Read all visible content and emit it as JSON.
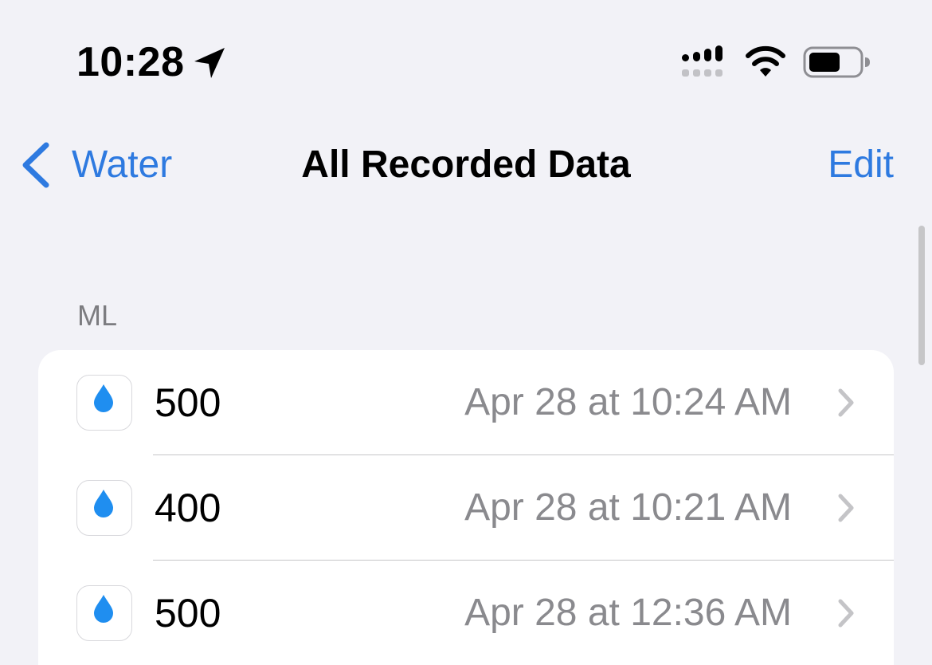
{
  "status_bar": {
    "time": "10:28",
    "icons": [
      "location-arrow-icon",
      "cellular-signal-icon",
      "wifi-icon",
      "battery-icon"
    ]
  },
  "nav": {
    "back_label": "Water",
    "title": "All Recorded Data",
    "edit_label": "Edit"
  },
  "section": {
    "header": "ML"
  },
  "records": [
    {
      "value": "500",
      "date": "Apr 28 at 10:24 AM"
    },
    {
      "value": "400",
      "date": "Apr 28 at 10:21 AM"
    },
    {
      "value": "500",
      "date": "Apr 28 at 12:36 AM"
    }
  ],
  "colors": {
    "accent": "#2e7ae0",
    "background": "#f2f2f7",
    "card": "#ffffff",
    "secondary_text": "#8a8a8e",
    "drop": "#1f8ef0"
  }
}
